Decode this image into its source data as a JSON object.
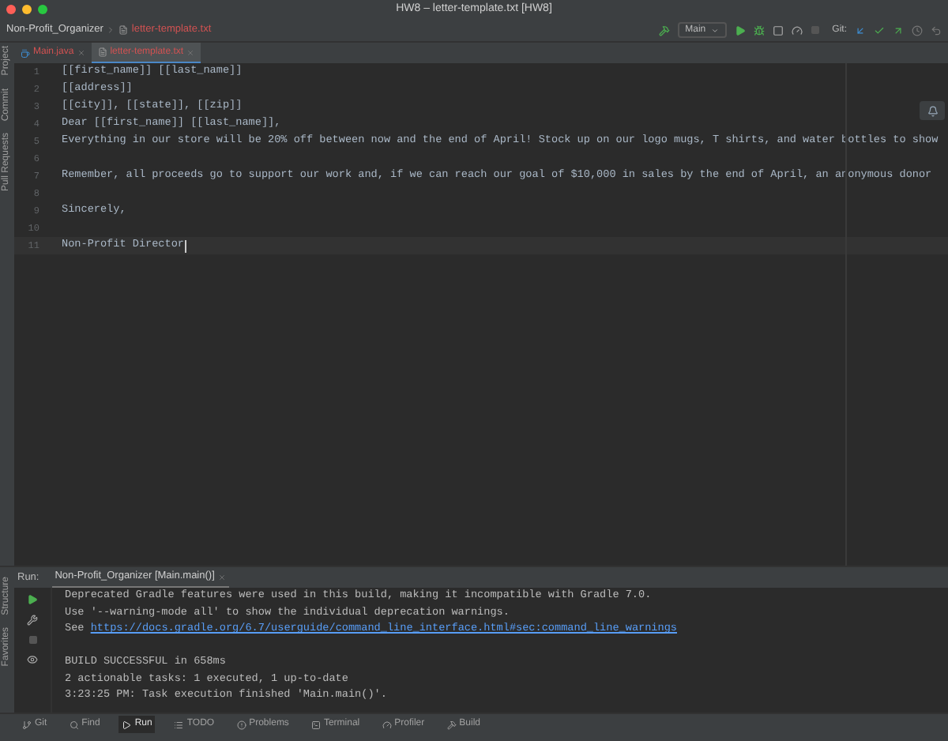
{
  "window": {
    "title": "HW8 – letter-template.txt [HW8]"
  },
  "breadcrumb": [
    "Non-Profit_Organizer",
    "letter-template.txt"
  ],
  "toolbar": {
    "config": "Main",
    "git_label": "Git:"
  },
  "left_strip_top": [
    "Project",
    "Commit",
    "Pull Requests"
  ],
  "left_strip_bottom": [
    "Structure",
    "Favorites"
  ],
  "tabs": [
    {
      "label": "Main.java",
      "kind": "java",
      "selected": false
    },
    {
      "label": "letter-template.txt",
      "kind": "text",
      "selected": true
    }
  ],
  "lines": [
    {
      "number": "1",
      "text": "[[first_name]] [[last_name]]",
      "current": false
    },
    {
      "number": "2",
      "text": "[[address]]",
      "current": false
    },
    {
      "number": "3",
      "text": "[[city]], [[state]], [[zip]]",
      "current": false
    },
    {
      "number": "4",
      "text": "Dear [[first_name]] [[last_name]],",
      "current": false
    },
    {
      "number": "5",
      "text": "Everything in our store will be 20% off between now and the end of April! Stock up on our logo mugs, T shirts, and water bottles to show",
      "current": false
    },
    {
      "number": "6",
      "current": false
    },
    {
      "number": "7",
      "text": "Remember, all proceeds go to support our work and, if we can reach our goal of $10,000 in sales by the end of April, an anonymous donor",
      "current": false
    },
    {
      "number": "8",
      "current": false
    },
    {
      "number": "9",
      "text": "Sincerely,",
      "current": false
    },
    {
      "number": "10",
      "current": false
    },
    {
      "number": "11",
      "text": "Non-Profit Director",
      "current": true
    }
  ],
  "run": {
    "label": "Run:",
    "tab": "Non-Profit_Organizer [Main.main()]",
    "console": [
      {
        "kind": "text",
        "text": "Deprecated Gradle features were used in this build, making it incompatible with Gradle 7.0."
      },
      {
        "kind": "text",
        "text": "Use '--warning-mode all' to show the individual deprecation warnings."
      },
      {
        "kind": "link",
        "prefix": "See ",
        "text": "https://docs.gradle.org/6.7/userguide/command_line_interface.html#sec:command_line_warnings"
      },
      {
        "kind": "blank"
      },
      {
        "kind": "text",
        "text": "BUILD SUCCESSFUL in 658ms"
      },
      {
        "kind": "text",
        "text": "2 actionable tasks: 1 executed, 1 up-to-date"
      },
      {
        "kind": "text",
        "text": "3:23:25 PM: Task execution finished 'Main.main()'."
      }
    ]
  },
  "bottom_tabs": [
    {
      "label": "Git",
      "kind": "git",
      "selected": false
    },
    {
      "label": "Find",
      "kind": "search",
      "selected": false
    },
    {
      "label": "Run",
      "kind": "play",
      "selected": true
    },
    {
      "label": "TODO",
      "kind": "list",
      "selected": false
    },
    {
      "label": "Problems",
      "kind": "alert",
      "selected": false
    },
    {
      "label": "Terminal",
      "kind": "terminal",
      "selected": false
    },
    {
      "label": "Profiler",
      "kind": "gauge",
      "selected": false
    },
    {
      "label": "Build",
      "kind": "hammer",
      "selected": false
    }
  ]
}
